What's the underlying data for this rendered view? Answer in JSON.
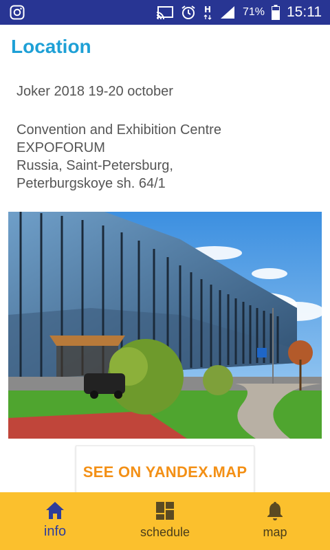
{
  "status_bar": {
    "left_icon": "instagram-icon",
    "icons": [
      "cast-icon",
      "alarm-icon",
      "network-h-icon",
      "signal-icon"
    ],
    "battery": "71%",
    "time": "15:11"
  },
  "page": {
    "title": "Location",
    "event": "Joker 2018 19-20 october",
    "address_lines": [
      "Convention and Exhibition Centre",
      "EXPOFORUM",
      "Russia, Saint-Petersburg,",
      "Peterburgskoye sh. 64/1"
    ],
    "image": "expoforum-building-photo"
  },
  "map_button": {
    "label": "SEE ON YANDEX.MAP"
  },
  "bottom_nav": {
    "items": [
      {
        "label": "info",
        "icon": "home-icon",
        "active": true
      },
      {
        "label": "schedule",
        "icon": "dashboard-icon",
        "active": false
      },
      {
        "label": "map",
        "icon": "bell-icon",
        "active": false
      }
    ]
  },
  "colors": {
    "status_bar": "#283593",
    "title": "#1ea0d6",
    "accent": "#f39016",
    "nav_bg": "#fbc02d",
    "nav_active": "#2f3d9a"
  }
}
